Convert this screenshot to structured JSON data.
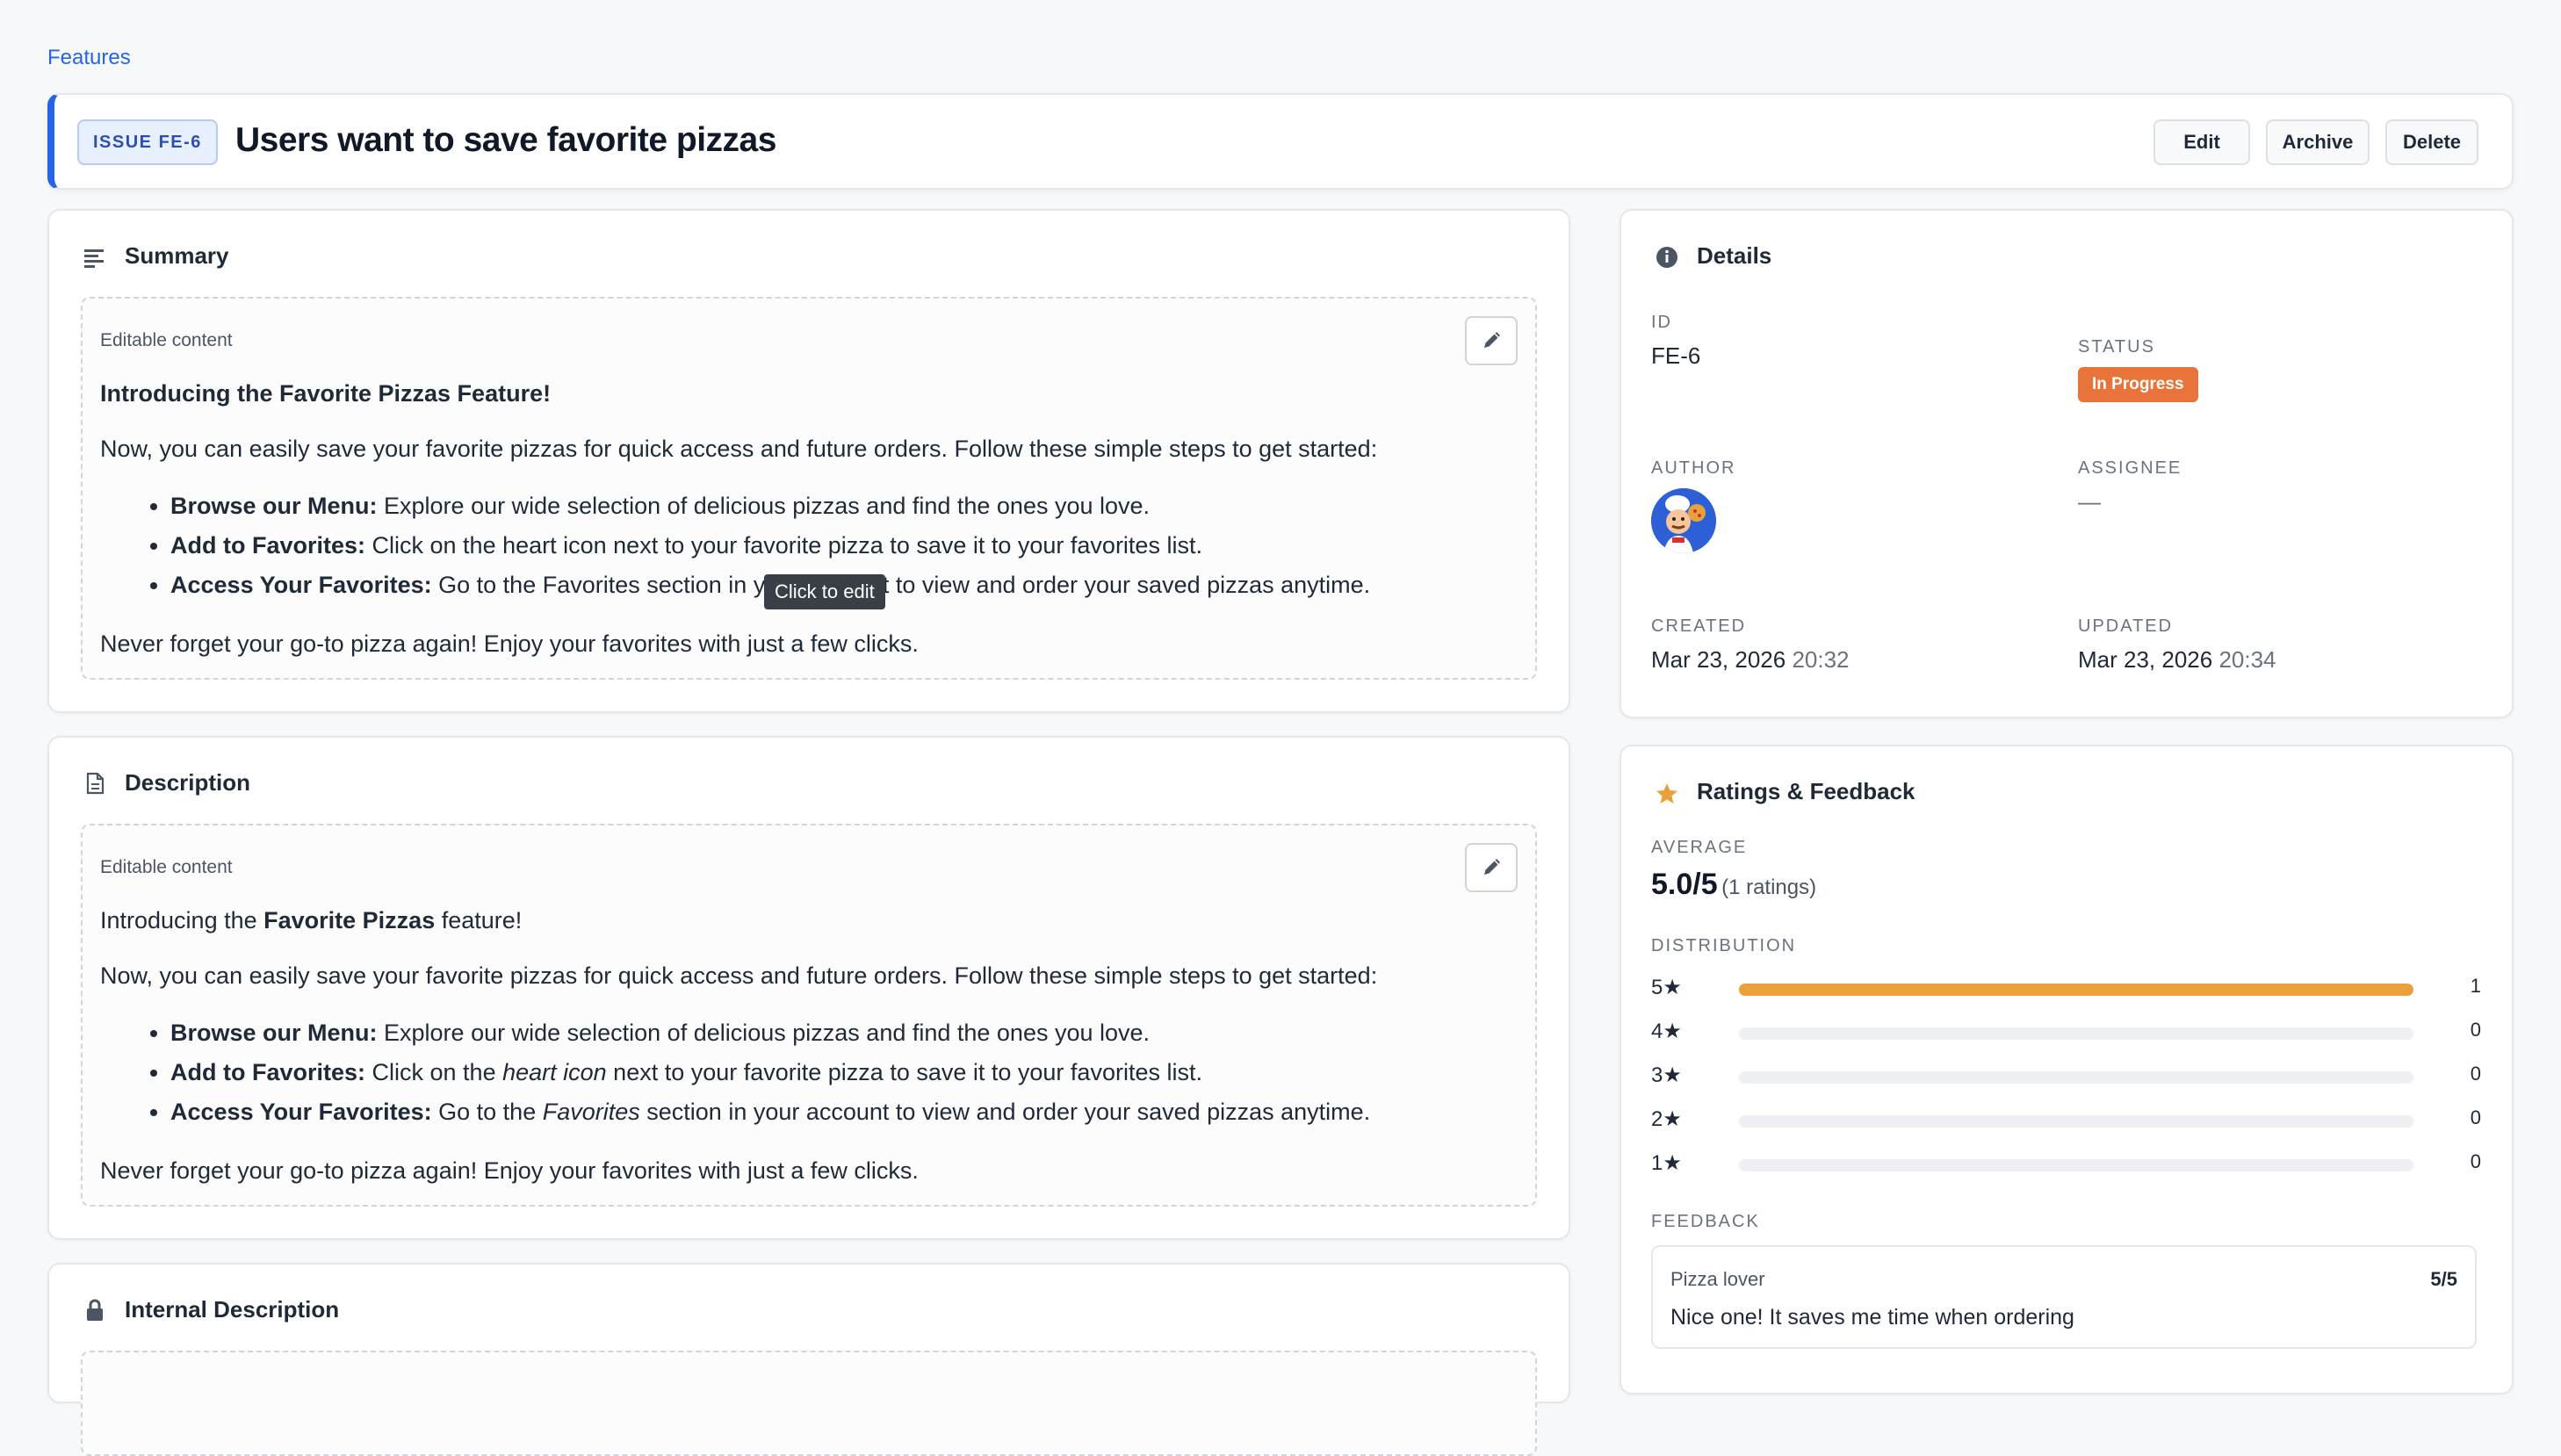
{
  "breadcrumb": "Features",
  "header": {
    "badge": "ISSUE FE-6",
    "title": "Users want to save favorite pizzas",
    "buttons": {
      "edit": "Edit",
      "archive": "Archive",
      "delete": "Delete"
    }
  },
  "summary": {
    "title": "Summary",
    "editable_label": "Editable content",
    "heading": "Introducing the Favorite Pizzas Feature!",
    "intro": "Now, you can easily save your favorite pizzas for quick access and future orders. Follow these simple steps to get started:",
    "items": [
      {
        "bold": "Browse our Menu:",
        "text": " Explore our wide selection of delicious pizzas and find the ones you love."
      },
      {
        "bold": "Add to Favorites:",
        "text": " Click on the heart icon next to your favorite pizza to save it to your favorites list."
      },
      {
        "bold": "Access Your Favorites:",
        "text": " Go to the Favorites section in your account to view and order your saved pizzas anytime."
      }
    ],
    "outro": "Never forget your go-to pizza again! Enjoy your favorites with just a few clicks."
  },
  "tooltip": "Click to edit",
  "description": {
    "title": "Description",
    "editable_label": "Editable content",
    "line1_pre": "Introducing the ",
    "line1_bold": "Favorite Pizzas",
    "line1_post": " feature!",
    "intro": "Now, you can easily save your favorite pizzas for quick access and future orders. Follow these simple steps to get started:",
    "item1_bold": "Browse our Menu:",
    "item1_text": " Explore our wide selection of delicious pizzas and find the ones you love.",
    "item2_bold": "Add to Favorites:",
    "item2_pre": " Click on the ",
    "item2_em": "heart icon",
    "item2_post": " next to your favorite pizza to save it to your favorites list.",
    "item3_bold": "Access Your Favorites:",
    "item3_pre": " Go to the ",
    "item3_em": "Favorites",
    "item3_post": " section in your account to view and order your saved pizzas anytime.",
    "outro": "Never forget your go-to pizza again! Enjoy your favorites with just a few clicks."
  },
  "internal": {
    "title": "Internal Description"
  },
  "details": {
    "title": "Details",
    "id_label": "ID",
    "id_value": "FE-6",
    "status_label": "STATUS",
    "status_value": "In Progress",
    "author_label": "AUTHOR",
    "assignee_label": "ASSIGNEE",
    "assignee_value": "—",
    "created_label": "CREATED",
    "created_date": "Mar 23, 2026",
    "created_time": "20:32",
    "updated_label": "UPDATED",
    "updated_date": "Mar 23, 2026",
    "updated_time": "20:34"
  },
  "ratings": {
    "title": "Ratings & Feedback",
    "average_label": "AVERAGE",
    "average_value": "5.0/5",
    "average_count": "(1 ratings)",
    "distribution_label": "DISTRIBUTION",
    "distribution": [
      {
        "label": "5★",
        "count": "1",
        "fraction": 1.0
      },
      {
        "label": "4★",
        "count": "0",
        "fraction": 0
      },
      {
        "label": "3★",
        "count": "0",
        "fraction": 0
      },
      {
        "label": "2★",
        "count": "0",
        "fraction": 0
      },
      {
        "label": "1★",
        "count": "0",
        "fraction": 0
      }
    ],
    "feedback_label": "FEEDBACK",
    "feedback": {
      "author": "Pizza lover",
      "score": "5/5",
      "text": "Nice one! It saves me time when ordering"
    }
  },
  "colors": {
    "accent": "#2563eb",
    "status": "#e8743b",
    "star": "#e9a23b"
  }
}
